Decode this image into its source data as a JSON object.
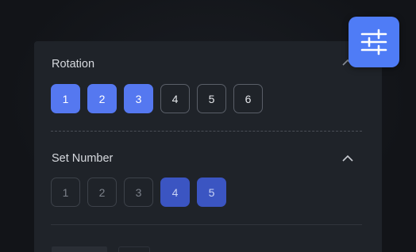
{
  "rotation": {
    "title": "Rotation",
    "options": [
      "1",
      "2",
      "3",
      "4",
      "5",
      "6"
    ],
    "selected": [
      "1",
      "2",
      "3"
    ]
  },
  "set_number": {
    "title": "Set Number",
    "options": [
      "1",
      "2",
      "3",
      "4",
      "5"
    ],
    "selected": [
      "4",
      "5"
    ]
  },
  "colors": {
    "accent": "#4f7cf6",
    "selected_active": "#5578f0",
    "selected_dim": "#3b55c2",
    "panel": "#1f2329",
    "background": "#131519"
  },
  "icons": {
    "filter_button": "sliders-icon",
    "collapse": "chevron-up-icon"
  }
}
